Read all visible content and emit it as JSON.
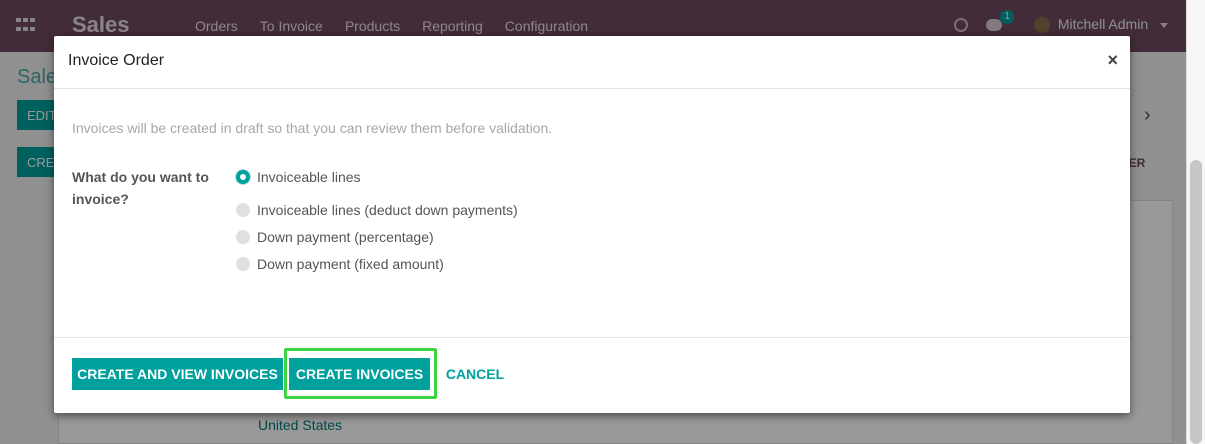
{
  "navbar": {
    "brand": "Sales",
    "menu": [
      "Orders",
      "To Invoice",
      "Products",
      "Reporting",
      "Configuration"
    ],
    "chat_count": "1",
    "user": "Mitchell Admin",
    "color": "#6f4a60"
  },
  "background": {
    "breadcrumb": "Sale",
    "edit_label": "EDIT",
    "create_label": "CRE",
    "order_label": "DER",
    "country": "United States"
  },
  "modal": {
    "title": "Invoice Order",
    "close_label": "×",
    "help_text": "Invoices will be created in draft so that you can review them before validation.",
    "question": "What do you want to invoice?",
    "options": [
      {
        "label": "Invoiceable lines",
        "checked": true
      },
      {
        "label": "Invoiceable lines (deduct down payments)",
        "checked": false
      },
      {
        "label": "Down payment (percentage)",
        "checked": false
      },
      {
        "label": "Down payment (fixed amount)",
        "checked": false
      }
    ],
    "buttons": {
      "create_view": "CREATE AND VIEW INVOICES",
      "create": "CREATE INVOICES",
      "cancel": "CANCEL"
    }
  },
  "colors": {
    "accent": "#00a09d",
    "highlight": "#3fd43f"
  }
}
